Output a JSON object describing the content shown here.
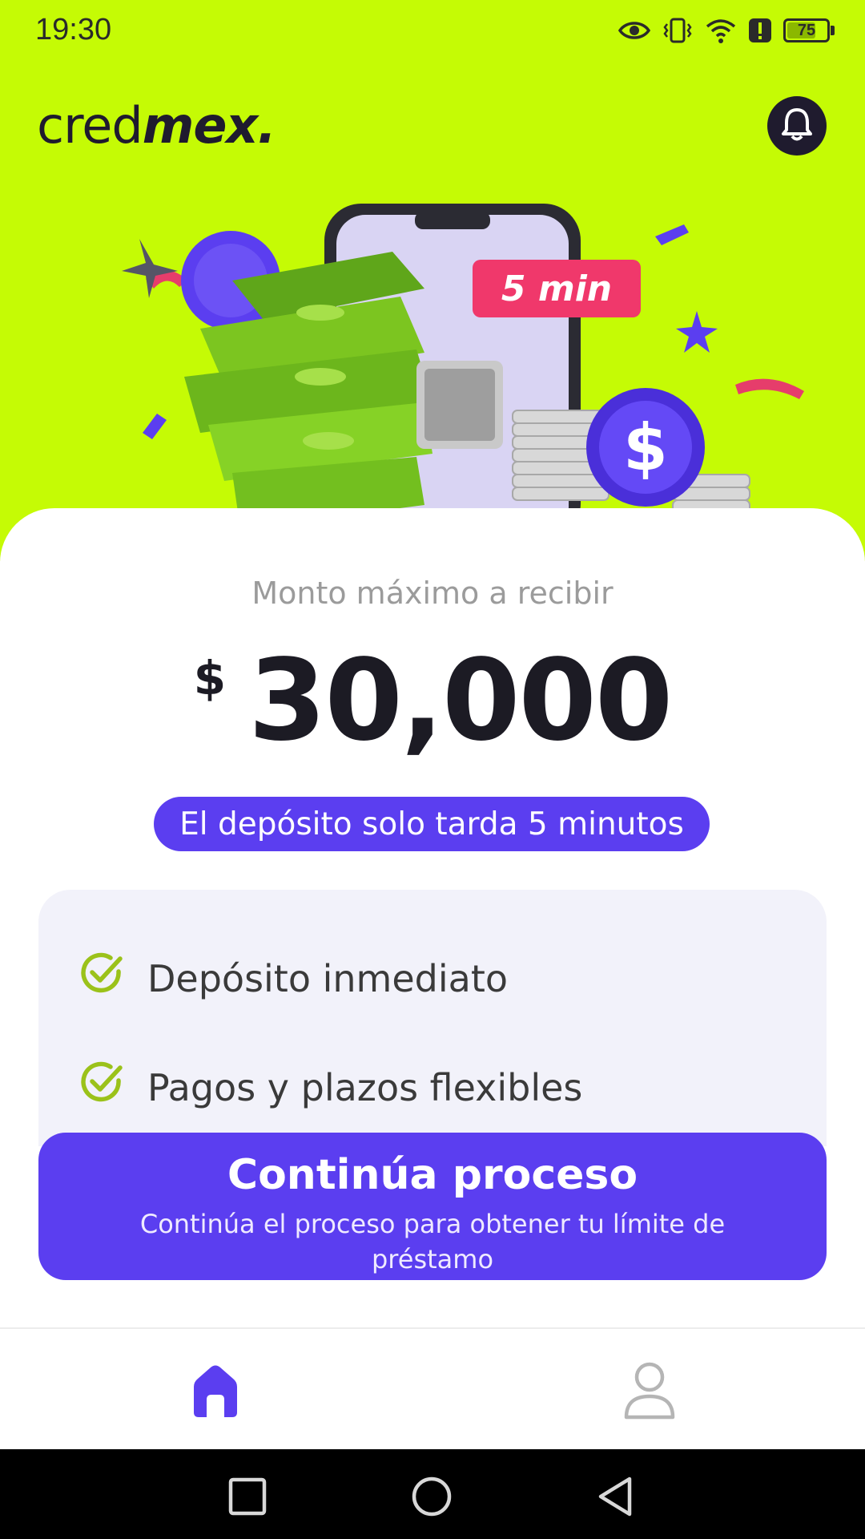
{
  "status_bar": {
    "time": "19:30",
    "battery": "75",
    "battery_level_percent": 75,
    "icons": [
      "eye-icon",
      "vibrate-icon",
      "wifi-icon",
      "alert-icon",
      "battery-icon"
    ]
  },
  "header": {
    "logo_light": "cred",
    "logo_bold": "mex.",
    "notification_icon": "bell-icon"
  },
  "hero": {
    "badge": "5 min"
  },
  "loan": {
    "caption": "Monto máximo a recibir",
    "currency": "$",
    "amount": "30,000",
    "deposit_note": "El depósito solo tarda 5 minutos"
  },
  "benefits": [
    {
      "label": "Depósito inmediato",
      "icon": "check-circle-icon"
    },
    {
      "label": "Pagos y plazos flexibles",
      "icon": "check-circle-icon"
    }
  ],
  "cta": {
    "title": "Continúa proceso",
    "subtitle": "Continúa el proceso para obtener tu límite de préstamo"
  },
  "bottom_nav": {
    "items": [
      {
        "name": "home",
        "icon": "home-icon",
        "active": true
      },
      {
        "name": "profile",
        "icon": "user-icon",
        "active": false
      }
    ]
  },
  "system_nav": {
    "icons": [
      "square-recents-icon",
      "circle-home-icon",
      "triangle-back-icon"
    ]
  },
  "colors": {
    "header_bg": "#c5fb05",
    "accent": "#5b3ef0",
    "text_dark": "#1c1b24",
    "check_green": "#9bc21a"
  }
}
